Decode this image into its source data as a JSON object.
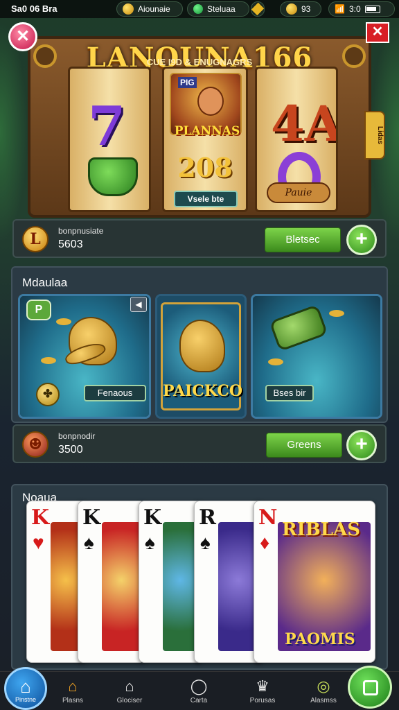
{
  "status_bar": {
    "time": "Sa0 06 Bra",
    "player_name": "Aiounaie",
    "gems_label": "Steluaa",
    "coins": "93",
    "signal": "3:0"
  },
  "slot": {
    "title": "LANOUNA166",
    "subtitle": "CUE I9D & ENUGNAGRS",
    "reel_center_tag": "PIG",
    "reel_center_name": "PLANNAS",
    "reel_center_number": "208",
    "reel_center_label": "Vsele bte",
    "reel_left_symbol": "7",
    "reel_right_symbol": "A",
    "reel_right_plate": "Pauie",
    "side_tab": "Lidas"
  },
  "balance1": {
    "icon_letter": "L",
    "label": "bonpnusiate",
    "value": "5603",
    "button": "Bletsec",
    "plus": "+"
  },
  "mission": {
    "title": "Mdaulaa",
    "tile_left_label": "Fenaous",
    "tile_left_chip": "P",
    "tile_center_label": "PAICKCO",
    "tile_right_label": "Bses bir"
  },
  "balance2": {
    "label": "bonpnodir",
    "value": "3500",
    "button": "Greens",
    "plus": "+"
  },
  "cards": {
    "title": "Noaua",
    "items": [
      {
        "rank": "K",
        "suit": "♥",
        "color": "red"
      },
      {
        "rank": "K",
        "suit": "♠",
        "color": "black"
      },
      {
        "rank": "K",
        "suit": "♠",
        "color": "black"
      },
      {
        "rank": "R",
        "suit": "♠",
        "color": "black"
      },
      {
        "rank": "N",
        "suit": "♦",
        "color": "red"
      }
    ],
    "feature_card_title": "RIBLAS",
    "feature_card_bottom": "PAOMIS"
  },
  "nav": {
    "home_label": "Pinstne",
    "items": [
      {
        "label": "Plasns",
        "icon": "house-icon"
      },
      {
        "label": "Glociser",
        "icon": "home-outline-icon"
      },
      {
        "label": "Carta",
        "icon": "circle-icon"
      },
      {
        "label": "Porusas",
        "icon": "crown-icon"
      },
      {
        "label": "Alasmss",
        "icon": "target-icon"
      }
    ]
  },
  "colors": {
    "accent_green": "#4fae2a",
    "close_red": "#d81e25",
    "gold": "#ffd54a"
  }
}
